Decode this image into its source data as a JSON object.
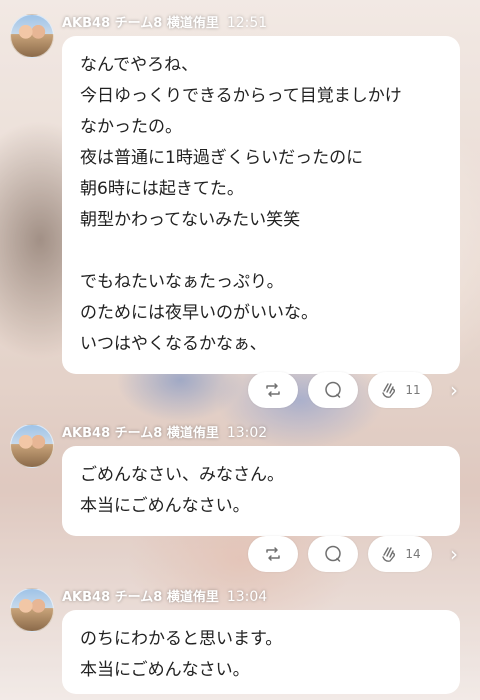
{
  "messages": [
    {
      "sender": "AKB48 チーム8 横道侑里",
      "time": "12:51",
      "lines": [
        "なんでやろね、",
        "今日ゆっくりできるからって目覚ましかけ",
        "なかったの。",
        "夜は普通に1時過ぎくらいだったのに",
        "朝6時には起きてた。",
        "朝型かわってないみたい笑笑",
        "",
        "でもねたいなぁたっぷり。",
        "のためには夜早いのがいいな。",
        "いつはやくなるかなぁ、"
      ],
      "claps": "11"
    },
    {
      "sender": "AKB48 チーム8 横道侑里",
      "time": "13:02",
      "lines": [
        "ごめんなさい、みなさん。",
        "本当にごめんなさい。"
      ],
      "claps": "14"
    },
    {
      "sender": "AKB48 チーム8 横道侑里",
      "time": "13:04",
      "lines": [
        "のちにわかると思います。",
        "本当にごめんなさい。"
      ]
    }
  ],
  "icons": {
    "repost": "repost-icon",
    "comment": "comment-icon",
    "clap": "clap-icon",
    "next": "chevron-right-icon"
  }
}
